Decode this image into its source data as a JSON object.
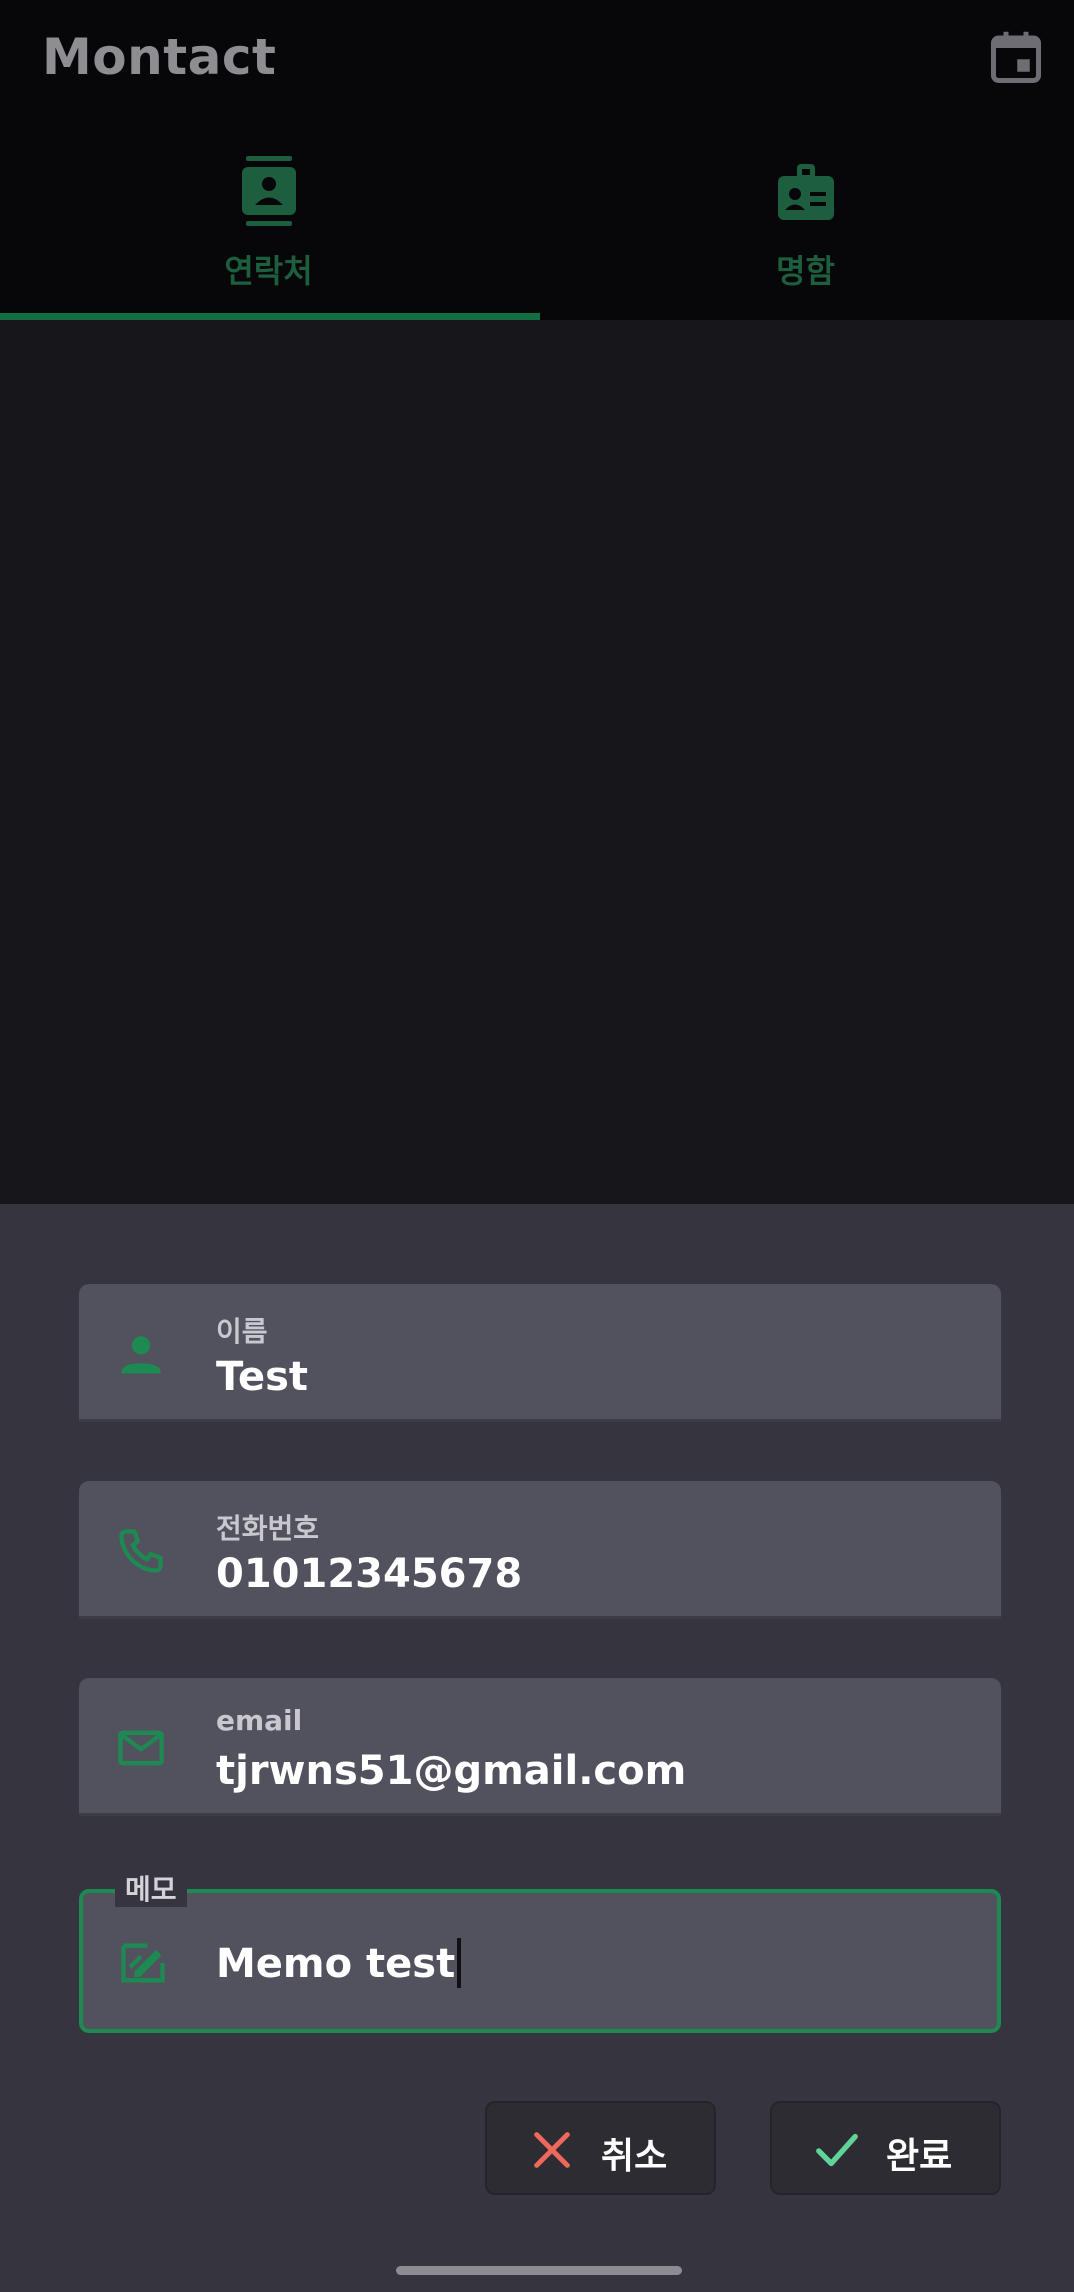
{
  "app": {
    "title": "Montact"
  },
  "header": {
    "calendar_icon": "calendar-icon"
  },
  "tabs": [
    {
      "label": "연락처",
      "icon": "contact-card-icon",
      "selected": true
    },
    {
      "label": "명함",
      "icon": "badge-icon",
      "selected": false
    }
  ],
  "form": {
    "name": {
      "label": "이름",
      "value": "Test",
      "icon": "person-icon"
    },
    "phone": {
      "label": "전화번호",
      "value": "01012345678",
      "icon": "phone-icon"
    },
    "email": {
      "label": "email",
      "value": "tjrwns51@gmail.com",
      "icon": "mail-icon"
    },
    "memo": {
      "label": "메모",
      "value": "Memo test",
      "icon": "edit-note-icon"
    }
  },
  "actions": {
    "cancel_label": "취소",
    "done_label": "완료"
  },
  "colors": {
    "accent": "#1d8a52",
    "cancel": "#f0675b",
    "done": "#5fd39a",
    "sheet_bg": "#36353f",
    "field_bg": "#52515e"
  }
}
